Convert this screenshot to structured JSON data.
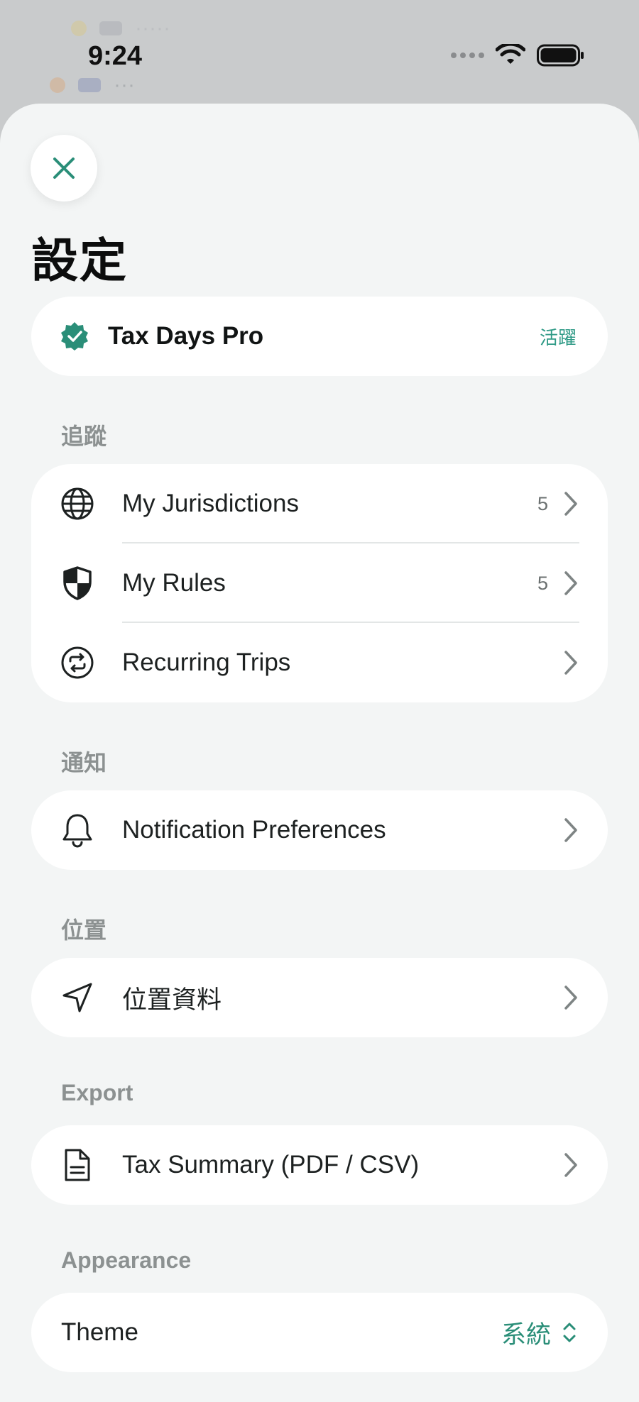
{
  "status_bar": {
    "time": "9:24"
  },
  "header": {
    "title": "設定"
  },
  "pro": {
    "name": "Tax Days Pro",
    "status": "活躍"
  },
  "sections": {
    "tracking": {
      "label": "追蹤",
      "items": [
        {
          "label": "My Jurisdictions",
          "count": "5",
          "icon": "globe-icon"
        },
        {
          "label": "My Rules",
          "count": "5",
          "icon": "shield-icon"
        },
        {
          "label": "Recurring Trips",
          "icon": "repeat-icon"
        }
      ]
    },
    "notifications": {
      "label": "通知",
      "items": [
        {
          "label": "Notification Preferences",
          "icon": "bell-icon"
        }
      ]
    },
    "location": {
      "label": "位置",
      "items": [
        {
          "label": "位置資料",
          "icon": "location-arrow-icon"
        }
      ]
    },
    "export": {
      "label": "Export",
      "items": [
        {
          "label": "Tax Summary (PDF / CSV)",
          "icon": "document-icon"
        }
      ]
    },
    "appearance": {
      "label": "Appearance",
      "theme_label": "Theme",
      "theme_value": "系統"
    }
  },
  "colors": {
    "accent": "#2a8e78",
    "sheet_background": "#f3f5f5",
    "card_background": "#ffffff",
    "section_label": "#8c9191"
  }
}
